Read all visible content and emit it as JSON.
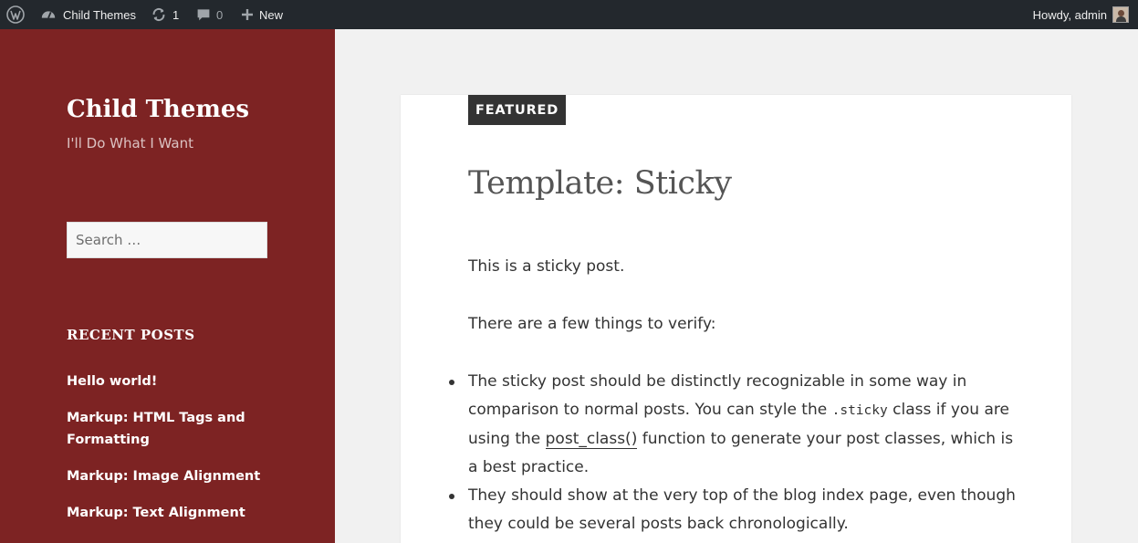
{
  "adminbar": {
    "site_name": "Child Themes",
    "updates_count": "1",
    "comments_count": "0",
    "new_label": "New",
    "howdy": "Howdy, admin"
  },
  "sidebar": {
    "site_title": "Child Themes",
    "site_description": "I'll Do What I Want",
    "search_placeholder": "Search …",
    "recent_posts_title": "RECENT POSTS",
    "recent_posts": [
      {
        "label": "Hello world!"
      },
      {
        "label": "Markup: HTML Tags and Formatting"
      },
      {
        "label": "Markup: Image Alignment"
      },
      {
        "label": "Markup: Text Alignment"
      }
    ]
  },
  "post": {
    "badge": "FEATURED",
    "title": "Template: Sticky",
    "p1": "This is a sticky post.",
    "p2": "There are a few things to verify:",
    "li1_a": "The sticky post should be distinctly recognizable in some way in comparison to normal posts. You can style the ",
    "li1_code": ".sticky",
    "li1_b": " class if you are using the ",
    "li1_link": "post_class()",
    "li1_c": " function to generate your post classes, which is a best practice.",
    "li2": "They should show at the very top of the blog index page, even though they could be several posts back chronologically."
  },
  "colors": {
    "sidebar_bg": "#7d2323",
    "adminbar_bg": "#23282d",
    "page_bg": "#f1f1f1"
  }
}
